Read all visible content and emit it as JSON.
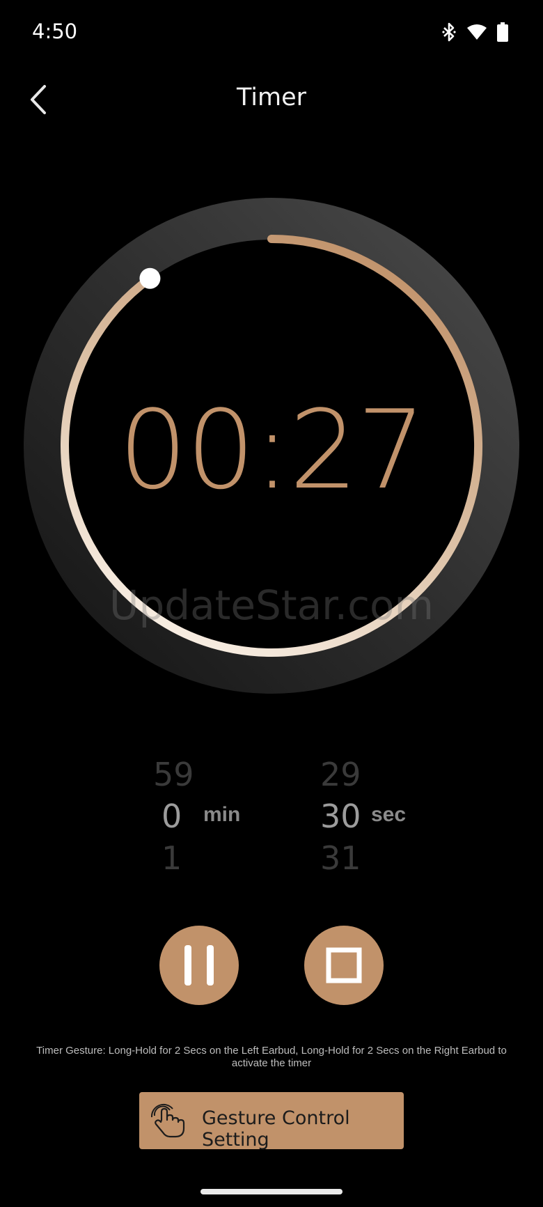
{
  "status_bar": {
    "time": "4:50",
    "icons": [
      "bluetooth-icon",
      "wifi-icon",
      "battery-icon"
    ]
  },
  "header": {
    "title": "Timer",
    "back_icon": "chevron-left-icon"
  },
  "timer": {
    "display": "00:27",
    "progress_fraction": 0.9
  },
  "watermark": "UpdateStar.com",
  "min_picker": {
    "prev": "59",
    "current": "0",
    "next": "1",
    "unit": "min"
  },
  "sec_picker": {
    "prev": "29",
    "current": "30",
    "next": "31",
    "unit": "sec"
  },
  "controls": {
    "pause_icon": "pause-icon",
    "stop_icon": "stop-icon"
  },
  "hint_text": "Timer Gesture: Long-Hold for 2 Secs on the Left Earbud, Long-Hold for 2 Secs on the Right Earbud to activate the timer",
  "gesture_button": {
    "label": "Gesture Control Setting",
    "icon": "hand-tap-icon"
  },
  "colors": {
    "accent": "#C1926A",
    "background": "#000000"
  }
}
